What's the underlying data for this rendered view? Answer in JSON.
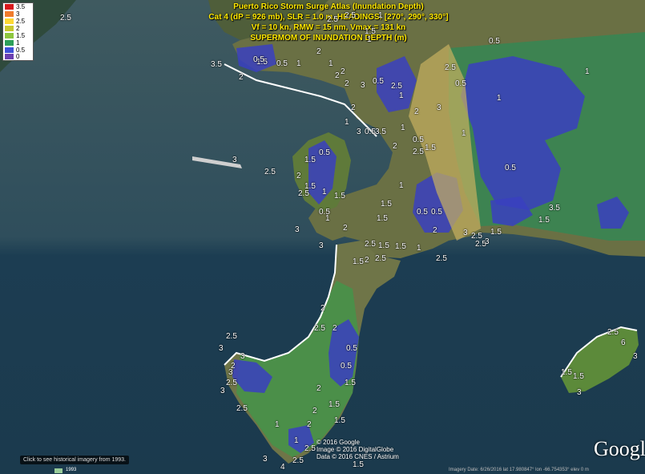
{
  "title": {
    "line1": "Puerto Rico Storm Surge Atlas (Inundation Depth)",
    "line2": "Cat 4 (dP = 926 mb), SLR = 1.0 m, HEADINGS: [270°, 290°, 330°]",
    "line3": "Vf = 10 kn, RMW = 15 nm, Vmax = 131 kn",
    "line4": "SUPERMOM OF INUNDATION DEPTH (m)"
  },
  "legend": [
    {
      "label": "3.5",
      "color": "#d7191c"
    },
    {
      "label": "3",
      "color": "#f07c2c"
    },
    {
      "label": "2.5",
      "color": "#fdd835"
    },
    {
      "label": "2",
      "color": "#c8c830"
    },
    {
      "label": "1.5",
      "color": "#8dc63f"
    },
    {
      "label": "1",
      "color": "#2ca05a"
    },
    {
      "label": "0.5",
      "color": "#3f51d8"
    },
    {
      "label": "0",
      "color": "#6a3fb0"
    }
  ],
  "contour_labels": [
    "2.5",
    "3.5",
    "2",
    "1.5",
    "0.5",
    "1",
    "0.5",
    "2",
    "1",
    "2",
    "2.5",
    "1",
    "1.5",
    "1",
    "0.5",
    "3",
    "2",
    "1",
    "0.5",
    "2.5",
    "1",
    "1",
    "2",
    "3",
    "3.5",
    "2",
    "2.5",
    "1.5",
    "0.5",
    "2",
    "1.5",
    "1",
    "0.5",
    "1.5",
    "2.5",
    "3",
    "2.5",
    "1",
    "0.5",
    "1",
    "0.5",
    "0.5",
    "1.5",
    "3.5",
    "3",
    "3",
    "3",
    "2.5",
    "1.5",
    "2.5",
    "2",
    "0.5",
    "1",
    "1",
    "2.5",
    "2.5",
    "2",
    "2",
    "1.5",
    "1.5",
    "1",
    "0.5",
    "2",
    "1.5",
    "2.5",
    "1.5",
    "0.5",
    "1.5",
    "3",
    "2.5",
    "3",
    "2",
    "1.5",
    "2.5",
    "1",
    "2",
    "2.5",
    "2",
    "0.5",
    "1.5",
    "2",
    "1.5",
    "2.5",
    "3",
    "3",
    "3",
    "1",
    "2",
    "2",
    "1",
    "1.5",
    "0.5",
    "2.5",
    "4",
    "3",
    "2.5",
    "1.5",
    "2.5",
    "3",
    "2",
    "2.5",
    "2.5",
    "3",
    "6",
    "3",
    "1.5",
    "1.5"
  ],
  "colors": {
    "ocean_deep": "#1f3d4f",
    "ocean_shallow": "#3a5a66",
    "land": "#5a6b3c",
    "title": "#ffe800"
  },
  "history_button": "Click to see historical imagery from 1993.",
  "copyright": [
    "© 2016 Google",
    "Image © 2016 DigitalGlobe",
    "Data © 2016 CNES / Astrium"
  ],
  "google_logo": "Google",
  "status_bar": "Imagery Date: 6/26/2016    lat  17.980847°  lon  -66.754353°  elev 0 m",
  "nav_year": "1993"
}
